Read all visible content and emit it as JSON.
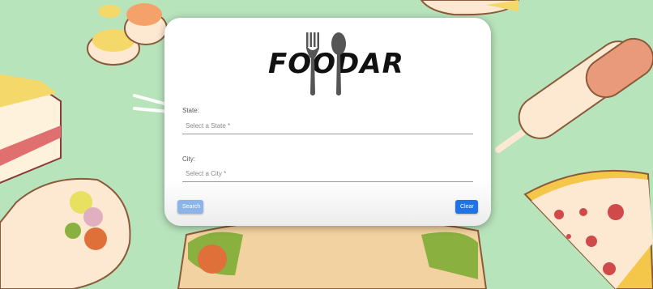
{
  "app": {
    "logo_text": "FOODAR"
  },
  "form": {
    "state_label": "State:",
    "state_placeholder": "Select a State *",
    "city_label": "City:",
    "city_placeholder": "Select a City *"
  },
  "actions": {
    "search_label": "Search",
    "clear_label": "Clear"
  },
  "colors": {
    "accent": "#1e73e6",
    "accent_disabled": "#8ab4ea",
    "background": "#b8e4bc"
  },
  "icons": [
    "fork-icon",
    "spoon-icon"
  ]
}
